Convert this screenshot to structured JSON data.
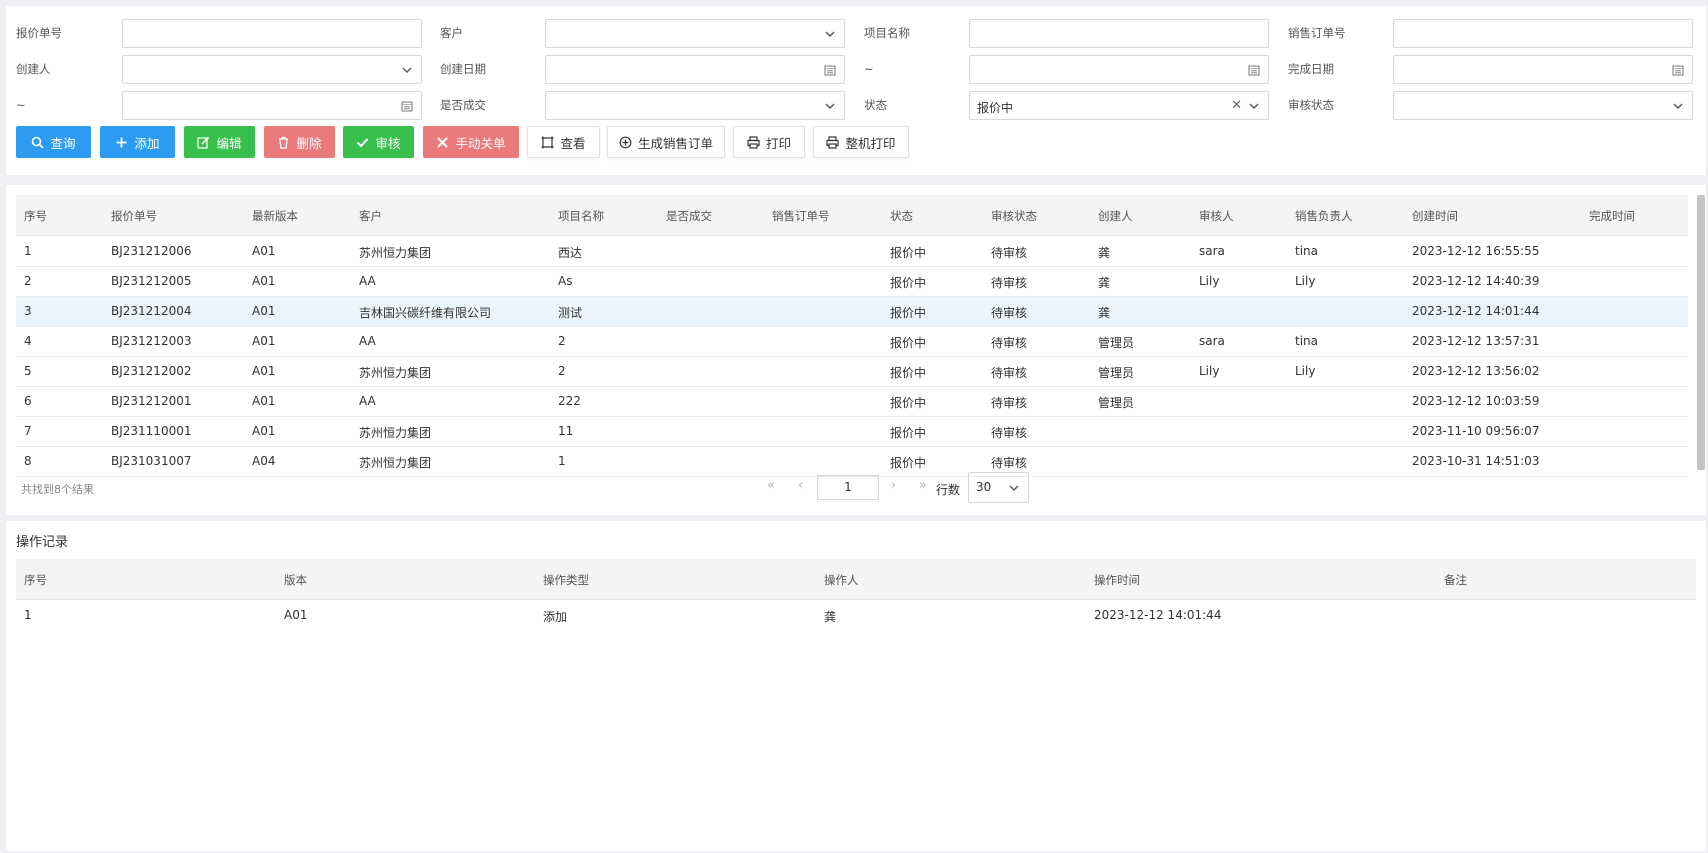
{
  "filters": {
    "quote_no": {
      "label": "报价单号",
      "value": ""
    },
    "customer": {
      "label": "客户",
      "value": ""
    },
    "project_name": {
      "label": "项目名称",
      "value": ""
    },
    "sales_order_no": {
      "label": "销售订单号",
      "value": ""
    },
    "creator": {
      "label": "创建人",
      "value": ""
    },
    "created_date": {
      "label": "创建日期",
      "value": ""
    },
    "created_date_to": {
      "label": "~",
      "value": ""
    },
    "completed_date": {
      "label": "完成日期",
      "value": ""
    },
    "completed_date_to": {
      "label": "~",
      "value": ""
    },
    "deal_closed": {
      "label": "是否成交",
      "value": ""
    },
    "status": {
      "label": "状态",
      "value": "报价中"
    },
    "audit_status": {
      "label": "审核状态",
      "value": ""
    }
  },
  "toolbar": {
    "query": "查询",
    "add": "添加",
    "edit": "编辑",
    "delete": "删除",
    "audit": "审核",
    "manual_close": "手动关单",
    "view": "查看",
    "gen_sales_order": "生成销售订单",
    "print": "打印",
    "full_print": "整机打印"
  },
  "grid": {
    "columns": [
      "序号",
      "报价单号",
      "最新版本",
      "客户",
      "项目名称",
      "是否成交",
      "销售订单号",
      "状态",
      "审核状态",
      "创建人",
      "审核人",
      "销售负责人",
      "创建时间",
      "完成时间"
    ],
    "rows": [
      [
        "1",
        "BJ231212006",
        "A01",
        "苏州恒力集团",
        "西达",
        "",
        "",
        "报价中",
        "待审核",
        "龚",
        "sara",
        "tina",
        "2023-12-12 16:55:55",
        ""
      ],
      [
        "2",
        "BJ231212005",
        "A01",
        "AA",
        "As",
        "",
        "",
        "报价中",
        "待审核",
        "龚",
        "Lily",
        "Lily",
        "2023-12-12 14:40:39",
        ""
      ],
      [
        "3",
        "BJ231212004",
        "A01",
        "吉林国兴碳纤维有限公司",
        "测试",
        "",
        "",
        "报价中",
        "待审核",
        "龚",
        "",
        "",
        "2023-12-12 14:01:44",
        ""
      ],
      [
        "4",
        "BJ231212003",
        "A01",
        "AA",
        "2",
        "",
        "",
        "报价中",
        "待审核",
        "管理员",
        "sara",
        "tina",
        "2023-12-12 13:57:31",
        ""
      ],
      [
        "5",
        "BJ231212002",
        "A01",
        "苏州恒力集团",
        "2",
        "",
        "",
        "报价中",
        "待审核",
        "管理员",
        "Lily",
        "Lily",
        "2023-12-12 13:56:02",
        ""
      ],
      [
        "6",
        "BJ231212001",
        "A01",
        "AA",
        "222",
        "",
        "",
        "报价中",
        "待审核",
        "管理员",
        "",
        "",
        "2023-12-12 10:03:59",
        ""
      ],
      [
        "7",
        "BJ231110001",
        "A01",
        "苏州恒力集团",
        "11",
        "",
        "",
        "报价中",
        "待审核",
        "",
        "",
        "",
        "2023-11-10 09:56:07",
        ""
      ],
      [
        "8",
        "BJ231031007",
        "A04",
        "苏州恒力集团",
        "1",
        "",
        "",
        "报价中",
        "待审核",
        "",
        "",
        "",
        "2023-10-31 14:51:03",
        ""
      ]
    ],
    "selected_row": 2,
    "result_text": "共找到8个结果",
    "page": "1",
    "rows_label": "行数",
    "rows_per_page": "30"
  },
  "log": {
    "title": "操作记录",
    "columns": [
      "序号",
      "版本",
      "操作类型",
      "操作人",
      "操作时间",
      "备注"
    ],
    "rows": [
      [
        "1",
        "A01",
        "添加",
        "龚",
        "2023-12-12 14:01:44",
        ""
      ]
    ]
  },
  "colors": {
    "primary": "#2d9cf0",
    "success": "#37c14c",
    "danger": "#eb7a7a",
    "selected_row": "#e9f4fd"
  }
}
